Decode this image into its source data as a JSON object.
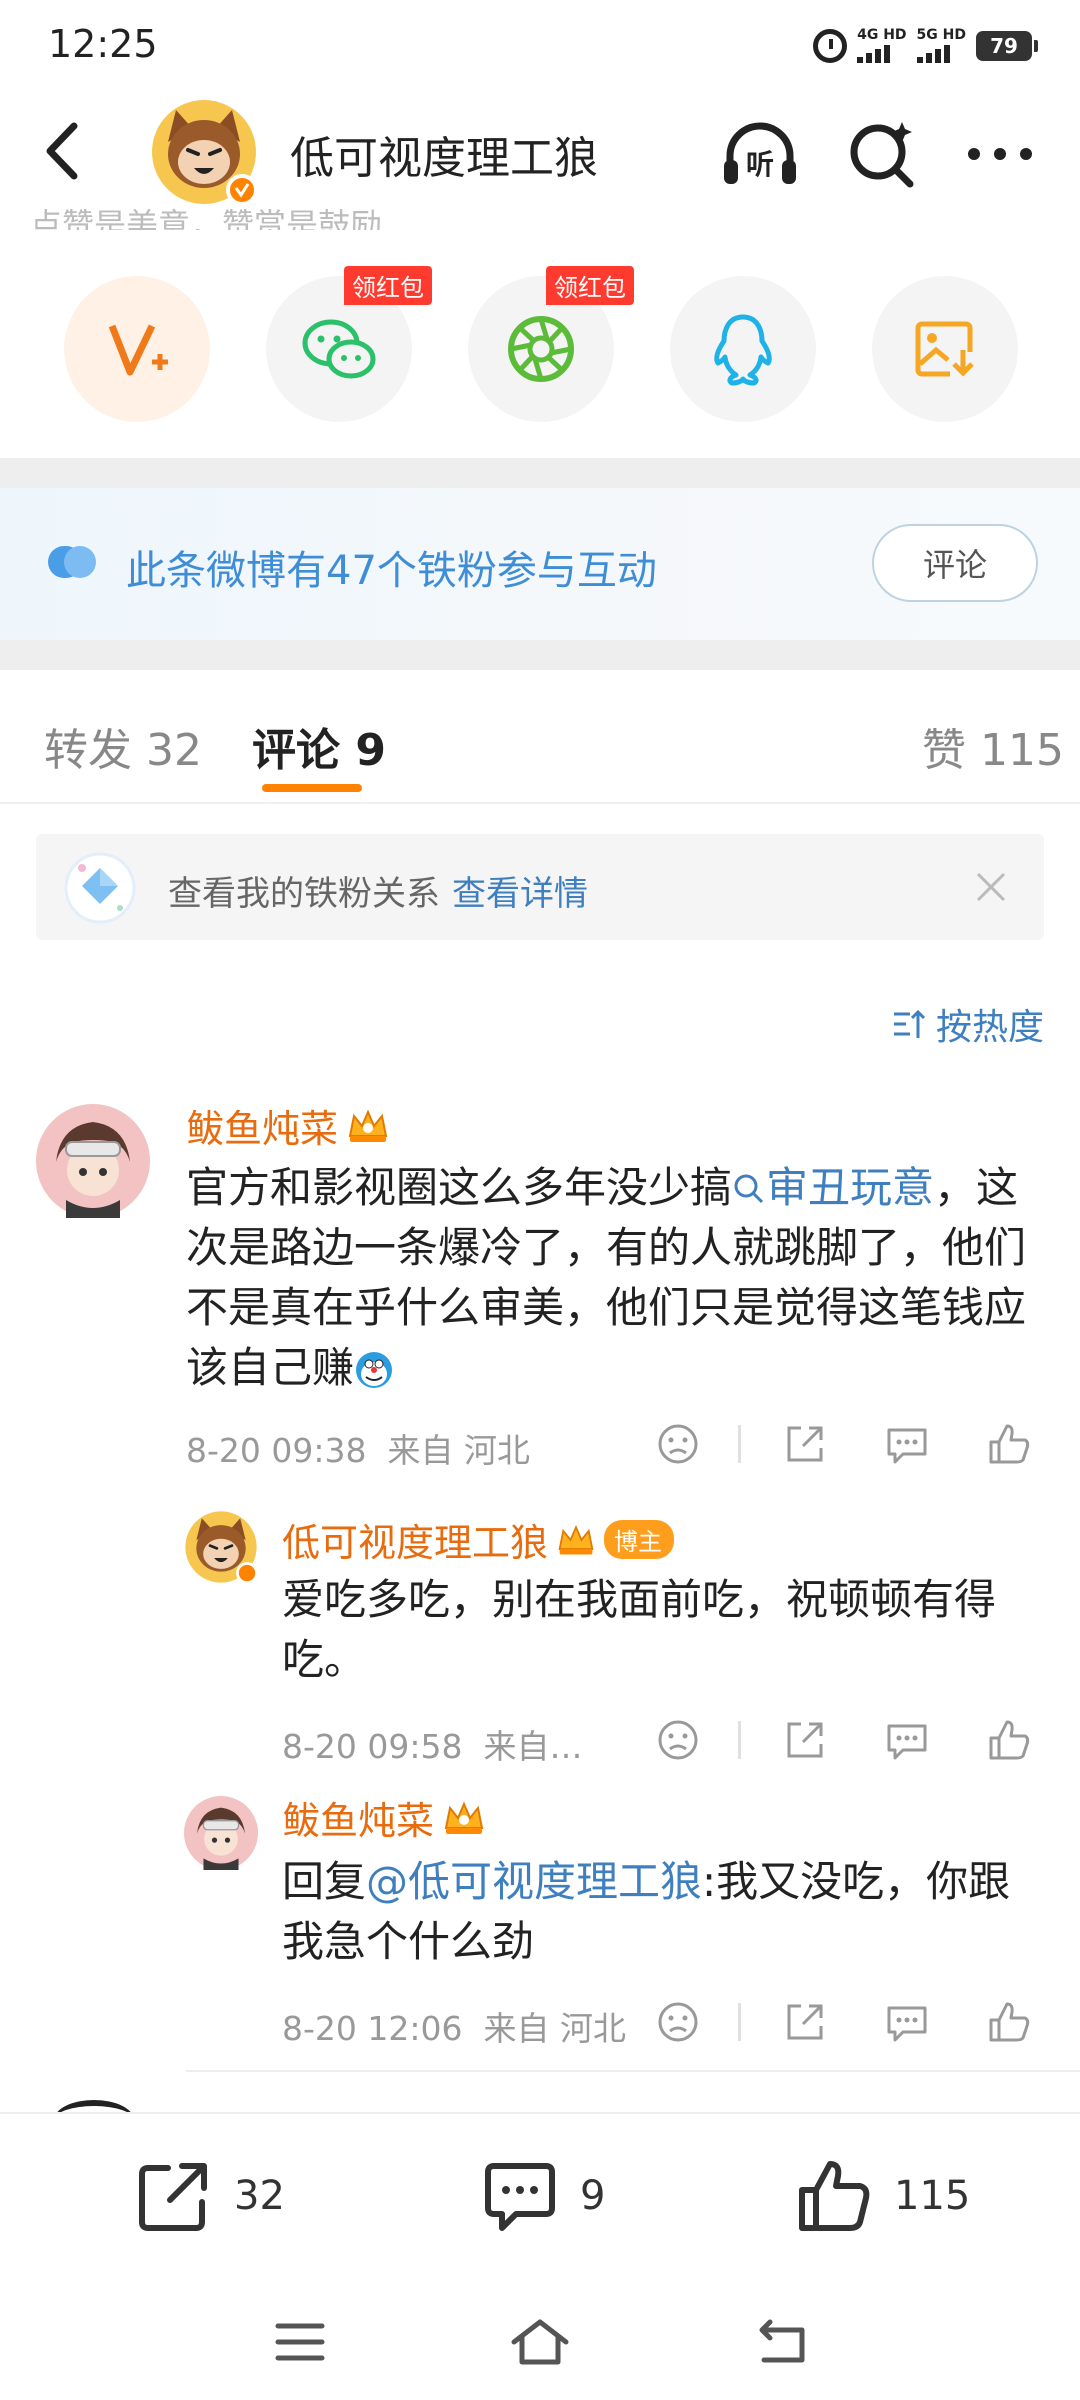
{
  "status_bar": {
    "time": "12:25",
    "signal_1": "4G HD",
    "signal_2": "5G HD",
    "battery": "79"
  },
  "header": {
    "title": "低可视度理工狼",
    "listen_label": "听"
  },
  "strip_text": "点赞是美意，赞赏是鼓励",
  "share_badges": [
    "领红包",
    "领红包"
  ],
  "fans_banner": {
    "text": "此条微博有47个铁粉参与互动",
    "button": "评论"
  },
  "tabs": {
    "repost": "转发",
    "repost_count": "32",
    "comment": "评论",
    "comment_count": "9",
    "like": "赞",
    "like_count": "115"
  },
  "relation": {
    "text": "查看我的铁粉关系",
    "link": "查看详情"
  },
  "sort_label": "按热度",
  "comments": [
    {
      "user": "鲅鱼炖菜",
      "text_before": "官方和影视圈这么多年没少搞",
      "topic": "审丑玩意",
      "text_after": "，这次是路边一条爆冷了，有的人就跳脚了，他们不是真在乎什么审美，他们只是觉得这笔钱应该自己赚",
      "time": "8-20 09:38",
      "location": "来自 河北"
    },
    {
      "user": "低可视度理工狼",
      "badge": "博主",
      "text": "爱吃多吃，别在我面前吃，祝顿顿有得吃。",
      "time": "8-20 09:58",
      "location": "来自…"
    },
    {
      "user": "鲅鱼炖菜",
      "reply_prefix": "回复",
      "mention": "@低可视度理工狼",
      "text": ":我又没吃，你跟我急个什么劲",
      "time": "8-20 12:06",
      "location": "来自 河北"
    }
  ],
  "bottom_bar": {
    "repost_count": "32",
    "comment_count": "9",
    "like_count": "115"
  },
  "colors": {
    "accent_orange": "#ff8200",
    "username_orange": "#e86b0e",
    "link_blue": "#3f7fbf",
    "wechat_green": "#2bc06a",
    "moments_green": "#5dbb3a",
    "qq_blue": "#1eb2e8",
    "save_orange": "#f5a623"
  },
  "icons": [
    "back-arrow-icon",
    "listen-icon",
    "search-icon",
    "more-icon",
    "vplus-icon",
    "wechat-icon",
    "moments-icon",
    "qq-icon",
    "save-image-icon",
    "close-icon",
    "dislike-icon",
    "share-icon",
    "comment-icon",
    "like-icon",
    "menu-icon",
    "home-icon",
    "return-icon"
  ]
}
